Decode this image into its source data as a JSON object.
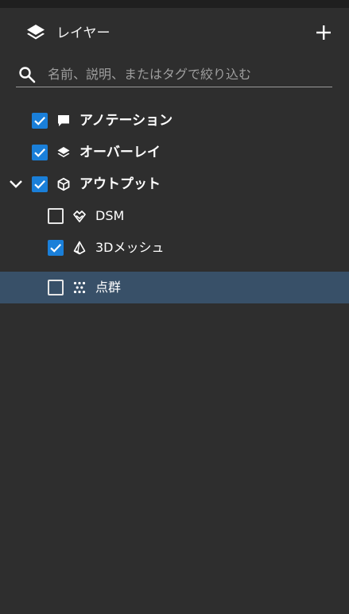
{
  "header": {
    "title": "レイヤー",
    "layers_icon": "layers-icon",
    "add_icon": "plus-icon"
  },
  "search": {
    "placeholder": "名前、説明、またはタグで絞り込む",
    "value": "",
    "icon": "search-icon"
  },
  "colors": {
    "background": "#2e2e2e",
    "checkbox_checked": "#1a7fd9",
    "selected_row": "#385068"
  },
  "tree": {
    "items": [
      {
        "label": "アノテーション",
        "checked": true,
        "icon": "comment-icon",
        "level": 0
      },
      {
        "label": "オーバーレイ",
        "checked": true,
        "icon": "layers-icon",
        "level": 0
      },
      {
        "label": "アウトプット",
        "checked": true,
        "icon": "cube-icon",
        "level": 0,
        "expanded": true
      },
      {
        "label": "DSM",
        "checked": false,
        "icon": "terrain-icon",
        "level": 1
      },
      {
        "label": "3Dメッシュ",
        "checked": true,
        "icon": "mesh-icon",
        "level": 1
      },
      {
        "label": "点群",
        "checked": false,
        "icon": "point-cloud-icon",
        "level": 1,
        "selected": true
      }
    ]
  }
}
